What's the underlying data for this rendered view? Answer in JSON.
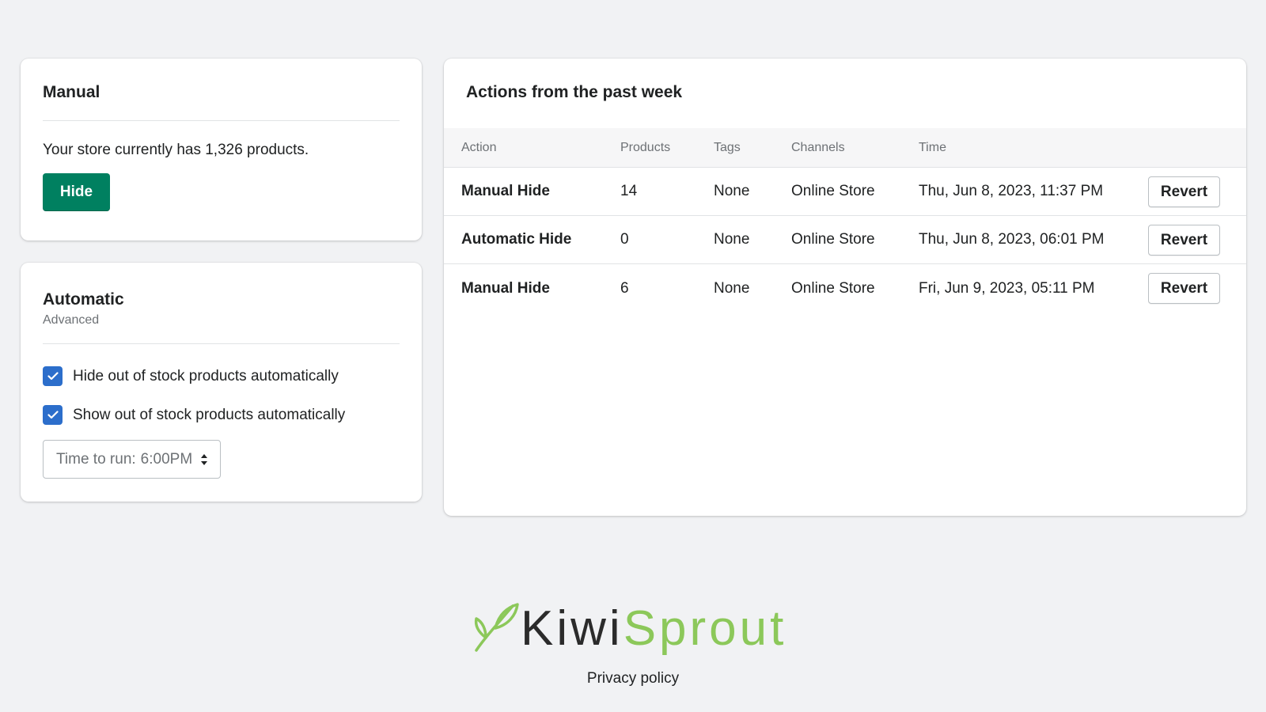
{
  "manual": {
    "title": "Manual",
    "description": "Your store currently has 1,326 products.",
    "hide_label": "Hide"
  },
  "automatic": {
    "title": "Automatic",
    "subtitle": "Advanced",
    "options": [
      {
        "label": "Hide out of stock products automatically",
        "checked": true
      },
      {
        "label": "Show out of stock products automatically",
        "checked": true
      }
    ],
    "time_select": {
      "prefix": "Time to run:",
      "value": "6:00PM"
    }
  },
  "actions": {
    "title": "Actions from the past week",
    "columns": [
      "Action",
      "Products",
      "Tags",
      "Channels",
      "Time"
    ],
    "rows": [
      {
        "action": "Manual Hide",
        "products": "14",
        "tags": "None",
        "channels": "Online Store",
        "time": "Thu, Jun 8, 2023, 11:37 PM",
        "button": "Revert"
      },
      {
        "action": "Automatic Hide",
        "products": "0",
        "tags": "None",
        "channels": "Online Store",
        "time": "Thu, Jun 8, 2023, 06:01 PM",
        "button": "Revert"
      },
      {
        "action": "Manual Hide",
        "products": "6",
        "tags": "None",
        "channels": "Online Store",
        "time": "Fri, Jun 9, 2023, 05:11 PM",
        "button": "Revert"
      }
    ]
  },
  "footer": {
    "logo_part1": "Kiwi",
    "logo_part2": "Sprout",
    "privacy_label": "Privacy policy"
  },
  "colors": {
    "primary_button": "#008060",
    "checkbox": "#2c6ecb",
    "logo_green": "#8cc85a",
    "background": "#f1f2f4"
  },
  "icons": {
    "checkbox": "checkmark-icon",
    "select": "select-arrows-icon",
    "logo": "sprout-leaf-icon"
  }
}
